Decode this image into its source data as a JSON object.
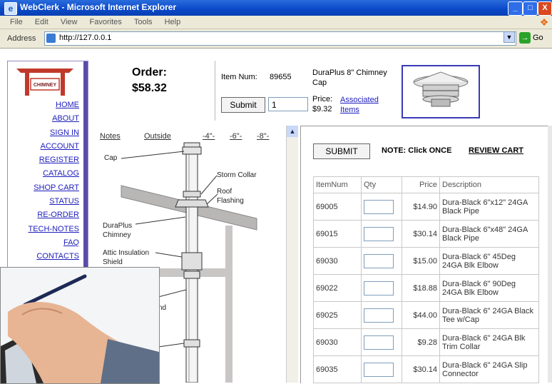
{
  "window": {
    "title": "WebClerk - Microsoft Internet Explorer",
    "minimize": "_",
    "maximize": "□",
    "close": "X",
    "ie_icon": "e"
  },
  "menu": [
    "File",
    "Edit",
    "View",
    "Favorites",
    "Tools",
    "Help"
  ],
  "address": {
    "label": "Address",
    "url": "http://127.0.0.1",
    "go_label": "Go"
  },
  "logo": {
    "text": "CHIMNEY"
  },
  "nav": [
    "HOME",
    "ABOUT",
    "SIGN IN",
    "ACCOUNT",
    "REGISTER",
    "CATALOG",
    "SHOP CART",
    "STATUS",
    "RE-ORDER",
    "TECH-NOTES",
    "FAQ",
    "CONTACTS"
  ],
  "order": {
    "label": "Order:",
    "total": "$58.32"
  },
  "item": {
    "num_label": "Item Num:",
    "num_value": "89655",
    "description": "DuraPlus 8\" Chimney Cap",
    "price_label": "Price:",
    "price_value": "$9.32",
    "associated_link": "Associated Items",
    "submit_label": "Submit",
    "qty_value": "1"
  },
  "diagram": {
    "links": [
      "Notes",
      "Outside",
      "-4\"-",
      "-6\"-",
      "-8\"-"
    ],
    "labels": {
      "cap": "Cap",
      "storm_collar": "Storm Collar",
      "roof_flashing": "Roof Flashing",
      "chimney": "DuraPlus Chimney",
      "attic_shield": "Attic Insulation Shield",
      "partial": "nd"
    }
  },
  "cart": {
    "submit_label": "SUBMIT",
    "note": "NOTE: Click ONCE",
    "review_link": "REVIEW CART",
    "headers": [
      "ItemNum",
      "Qty",
      "Price",
      "Description"
    ],
    "rows": [
      {
        "item": "69005",
        "price": "$14.90",
        "desc": "Dura-Black 6\"x12\" 24GA Black Pipe"
      },
      {
        "item": "69015",
        "price": "$30.14",
        "desc": "Dura-Black 6\"x48\" 24GA Black Pipe"
      },
      {
        "item": "69030",
        "price": "$15.00",
        "desc": "Dura-Black 6\" 45Deg 24GA Blk Elbow"
      },
      {
        "item": "69022",
        "price": "$18.88",
        "desc": "Dura-Black 6\" 90Deg 24GA Blk Elbow"
      },
      {
        "item": "69025",
        "price": "$44.00",
        "desc": "Dura-Black 6\" 24GA Black Tee w/Cap"
      },
      {
        "item": "69030",
        "price": "$9.28",
        "desc": "Dura-Black 6\" 24GA Blk Trim Collar"
      },
      {
        "item": "69035",
        "price": "$30.14",
        "desc": "Dura-Black 6\" 24GA Slip Connector"
      }
    ]
  }
}
